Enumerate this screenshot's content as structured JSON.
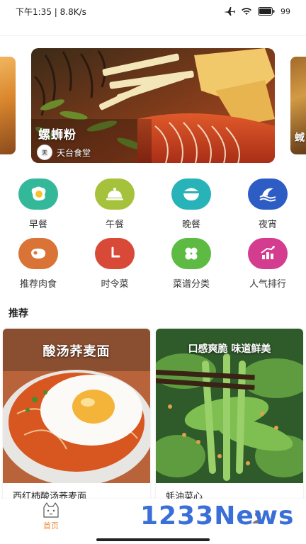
{
  "status_bar": {
    "time": "下午1:35 | 8.8K/s",
    "battery": "99"
  },
  "banner": {
    "title": "螺蛳粉",
    "author": "天台食堂",
    "right_peek_text": "蜮"
  },
  "categories": [
    {
      "label": "早餐",
      "icon": "egg-icon",
      "color": "#33b99a"
    },
    {
      "label": "午餐",
      "icon": "cloche-icon",
      "color": "#a6c23c"
    },
    {
      "label": "晚餐",
      "icon": "bowl-icon",
      "color": "#27b3b7"
    },
    {
      "label": "夜宵",
      "icon": "night-wave-icon",
      "color": "#2d5cc4"
    },
    {
      "label": "推荐肉食",
      "icon": "meat-icon",
      "color": "#d97336"
    },
    {
      "label": "时令菜",
      "icon": "clock-icon",
      "color": "#d84a37"
    },
    {
      "label": "菜谱分类",
      "icon": "clover-icon",
      "color": "#5dbb43"
    },
    {
      "label": "人气排行",
      "icon": "bar-chart-icon",
      "color": "#d43c8f"
    }
  ],
  "recommend": {
    "title": "推荐",
    "items": [
      {
        "overlay": "酸汤荞麦面",
        "name": "西红柿酸汤荞麦面"
      },
      {
        "overlay": "口感爽脆 味道鲜美",
        "name": "蚝油菜心"
      }
    ]
  },
  "bottom_nav": {
    "home_label": "首页",
    "accent": "#f08a3c"
  },
  "watermark": "1233News"
}
